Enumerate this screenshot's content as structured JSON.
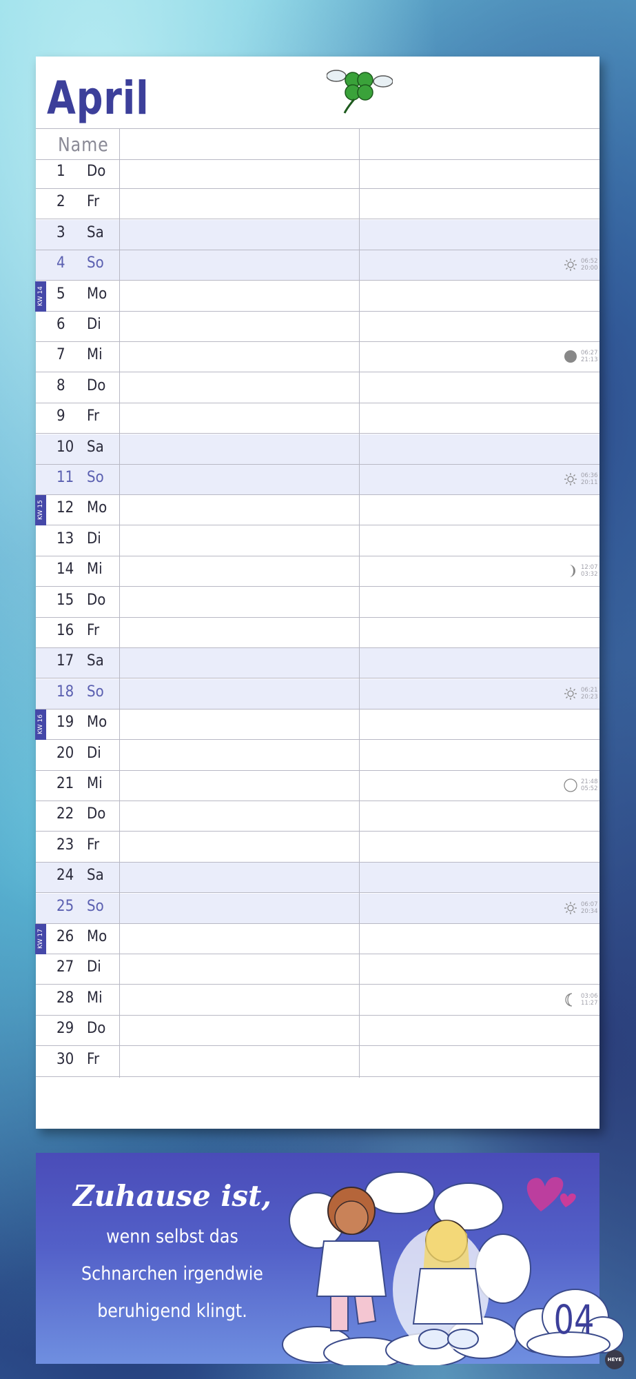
{
  "month": "April",
  "header": {
    "name_label": "Name"
  },
  "days": [
    {
      "num": "1",
      "day": "Do"
    },
    {
      "num": "2",
      "day": "Fr"
    },
    {
      "num": "3",
      "day": "Sa"
    },
    {
      "num": "4",
      "day": "So",
      "astro": {
        "icon": "sun-icon",
        "t1": "06:52",
        "t2": "20:00"
      }
    },
    {
      "num": "5",
      "day": "Mo",
      "kw": "KW 14"
    },
    {
      "num": "6",
      "day": "Di"
    },
    {
      "num": "7",
      "day": "Mi",
      "astro": {
        "icon": "new-moon-icon",
        "t1": "06:27",
        "t2": "21:13"
      }
    },
    {
      "num": "8",
      "day": "Do"
    },
    {
      "num": "9",
      "day": "Fr"
    },
    {
      "num": "10",
      "day": "Sa"
    },
    {
      "num": "11",
      "day": "So",
      "astro": {
        "icon": "sun-icon",
        "t1": "06:36",
        "t2": "20:11"
      }
    },
    {
      "num": "12",
      "day": "Mo",
      "kw": "KW 15"
    },
    {
      "num": "13",
      "day": "Di"
    },
    {
      "num": "14",
      "day": "Mi",
      "astro": {
        "icon": "waxing-moon-icon",
        "t1": "12:07",
        "t2": "03:32"
      }
    },
    {
      "num": "15",
      "day": "Do"
    },
    {
      "num": "16",
      "day": "Fr"
    },
    {
      "num": "17",
      "day": "Sa"
    },
    {
      "num": "18",
      "day": "So",
      "astro": {
        "icon": "sun-icon",
        "t1": "06:21",
        "t2": "20:23"
      }
    },
    {
      "num": "19",
      "day": "Mo",
      "kw": "KW 16"
    },
    {
      "num": "20",
      "day": "Di"
    },
    {
      "num": "21",
      "day": "Mi",
      "astro": {
        "icon": "full-moon-icon",
        "t1": "21:48",
        "t2": "05:52"
      }
    },
    {
      "num": "22",
      "day": "Do"
    },
    {
      "num": "23",
      "day": "Fr"
    },
    {
      "num": "24",
      "day": "Sa"
    },
    {
      "num": "25",
      "day": "So",
      "astro": {
        "icon": "sun-icon",
        "t1": "06:07",
        "t2": "20:34"
      }
    },
    {
      "num": "26",
      "day": "Mo",
      "kw": "KW 17"
    },
    {
      "num": "27",
      "day": "Di"
    },
    {
      "num": "28",
      "day": "Mi",
      "astro": {
        "icon": "waning-moon-icon",
        "t1": "03:06",
        "t2": "11:27"
      }
    },
    {
      "num": "29",
      "day": "Do"
    },
    {
      "num": "30",
      "day": "Fr"
    }
  ],
  "quote": {
    "line1": "Zuhause ist,",
    "line2": "wenn selbst das",
    "line3": "Schnarchen irgendwie",
    "line4": "beruhigend klingt."
  },
  "page_number": "04",
  "brand": "HEYE",
  "colors": {
    "accent": "#3c3f9a",
    "weekend_row": "#eaedfa",
    "kw_badge": "#4548a8"
  }
}
